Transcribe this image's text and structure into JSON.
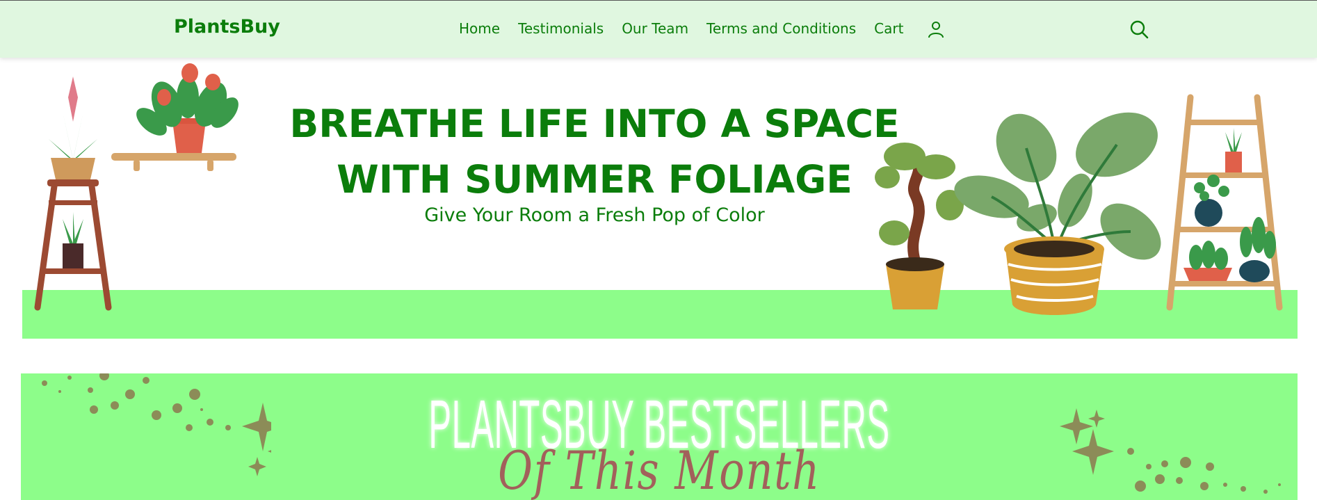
{
  "navbar": {
    "brand": "PlantsBuy",
    "links": [
      "Home",
      "Testimonials",
      "Our Team",
      "Terms and Conditions",
      "Cart"
    ],
    "icons": [
      "user-icon",
      "search-icon"
    ]
  },
  "hero": {
    "title_line1": "BREATHE LIFE INTO A SPACE",
    "title_line2": "WITH SUMMER FOLIAGE",
    "subtitle": "Give Your Room a Fresh Pop of Color"
  },
  "bestsellers": {
    "title": "PLANTSBUY BESTSELLERS",
    "script": "Of This Month"
  },
  "colors": {
    "brand_green": "#0b7d0b",
    "nav_bg": "#e0f7e0",
    "accent_green": "#8dfd8a",
    "sparkle": "#8c8c58"
  }
}
